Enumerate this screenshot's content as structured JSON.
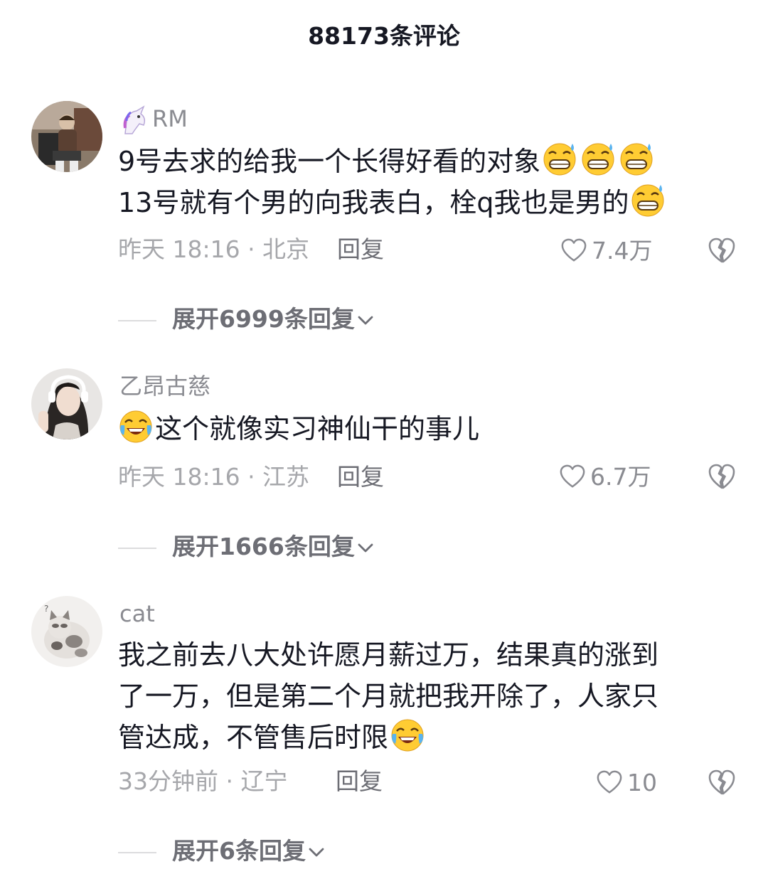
{
  "header": {
    "title": "88173条评论"
  },
  "comments": [
    {
      "username": "RM",
      "line1": "9号去求的给我一个长得好看的对象",
      "line2": "13号就有个男的向我表白，栓q我也是男的",
      "meta": "昨天 18:16 · 北京",
      "reply": "回复",
      "likes": "7.4万",
      "expand": "展开6999条回复"
    },
    {
      "username": "乙昂古慈",
      "line1": "这个就像实习神仙干的事儿",
      "meta": "昨天 18:16 · 江苏",
      "reply": "回复",
      "likes": "6.7万",
      "expand": "展开1666条回复"
    },
    {
      "username": "cat",
      "line1": "我之前去八大处许愿月薪过万，结果真的涨到",
      "line2": "了一万，但是第二个月就把我开除了，人家只",
      "line3": "管达成，不管售后时限",
      "meta": "33分钟前 · 辽宁",
      "reply": "回复",
      "likes": "10",
      "expand": "展开6条回复"
    }
  ],
  "icons": {
    "badge": "unicorn-icon",
    "emoji_grin_sweat": "grinning-sweat-emoji-icon",
    "emoji_laugh_cry": "laughing-crying-emoji-icon",
    "like": "heart-outline-icon",
    "dislike": "broken-heart-icon",
    "expand": "chevron-down-icon"
  }
}
